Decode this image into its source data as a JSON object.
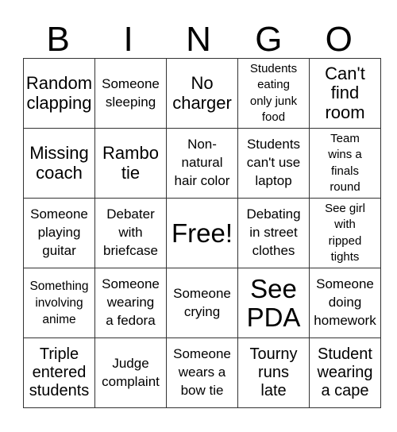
{
  "header": {
    "letters": [
      "B",
      "I",
      "N",
      "G",
      "O"
    ]
  },
  "board": {
    "rows": [
      [
        {
          "text": "Random\nclapping",
          "size": "l"
        },
        {
          "text": "Someone\nsleeping",
          "size": "s"
        },
        {
          "text": "No\ncharger",
          "size": "l"
        },
        {
          "text": "Students\neating\nonly junk\nfood",
          "size": "xxs"
        },
        {
          "text": "Can't\nfind\nroom",
          "size": "l"
        }
      ],
      [
        {
          "text": "Missing\ncoach",
          "size": "l"
        },
        {
          "text": "Rambo\ntie",
          "size": "l"
        },
        {
          "text": "Non-\nnatural\nhair color",
          "size": "s"
        },
        {
          "text": "Students\ncan't use\nlaptop",
          "size": "s"
        },
        {
          "text": "Team\nwins a\nfinals\nround",
          "size": "xxs"
        }
      ],
      [
        {
          "text": "Someone\nplaying\nguitar",
          "size": "s"
        },
        {
          "text": "Debater\nwith\nbriefcase",
          "size": "s"
        },
        {
          "text": "Free!",
          "size": "xl"
        },
        {
          "text": "Debating\nin street\nclothes",
          "size": "s"
        },
        {
          "text": "See girl\nwith\nripped\ntights",
          "size": "xxs"
        }
      ],
      [
        {
          "text": "Something\ninvolving\nanime",
          "size": "xs"
        },
        {
          "text": "Someone\nwearing\na fedora",
          "size": "s"
        },
        {
          "text": "Someone\ncrying",
          "size": "s"
        },
        {
          "text": "See\nPDA",
          "size": "xl"
        },
        {
          "text": "Someone\ndoing\nhomework",
          "size": "s"
        }
      ],
      [
        {
          "text": "Triple\nentered\nstudents",
          "size": "m"
        },
        {
          "text": "Judge\ncomplaint",
          "size": "s"
        },
        {
          "text": "Someone\nwears a\nbow tie",
          "size": "s"
        },
        {
          "text": "Tourny\nruns\nlate",
          "size": "m"
        },
        {
          "text": "Student\nwearing\na cape",
          "size": "m"
        }
      ]
    ]
  }
}
